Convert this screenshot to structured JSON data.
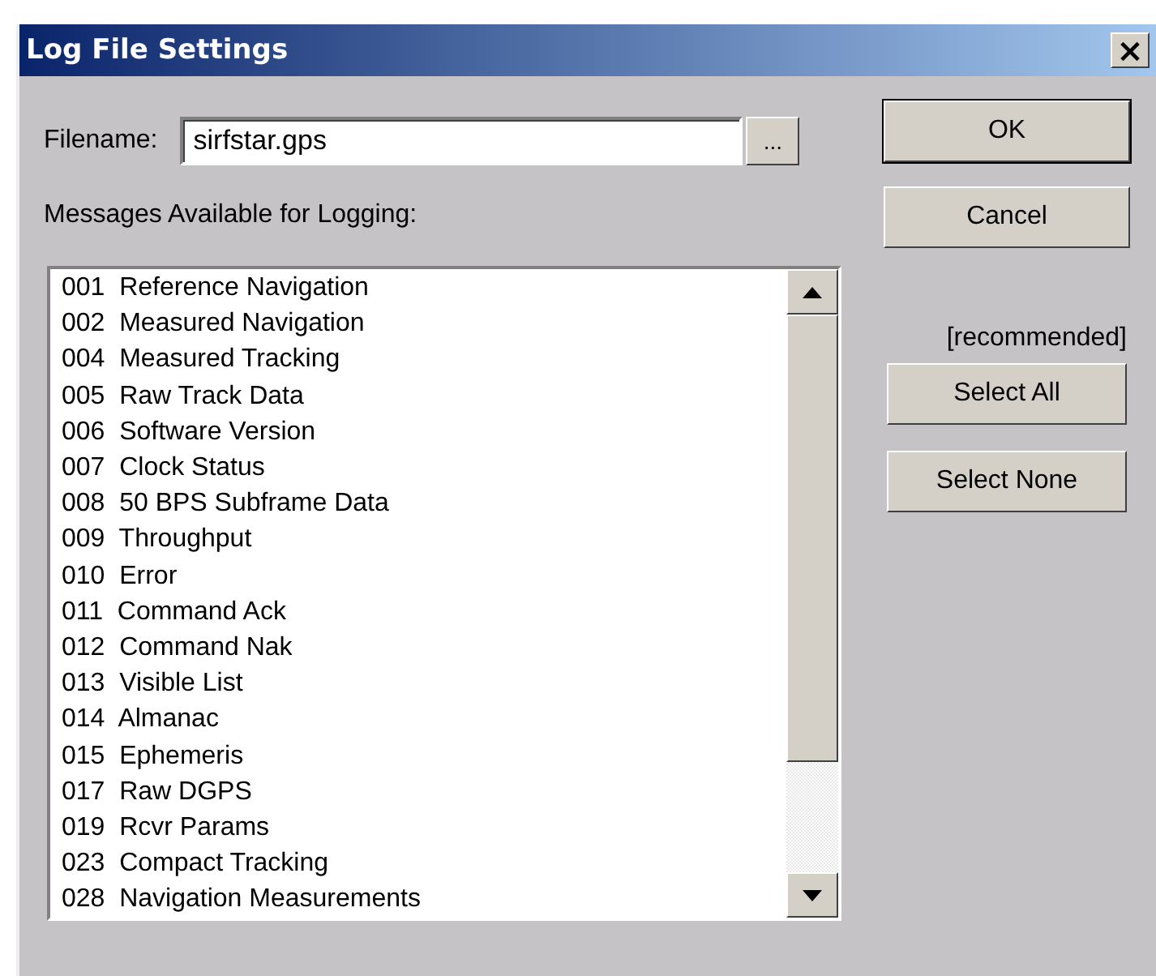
{
  "window": {
    "title": "Log File Settings",
    "close_label": "×"
  },
  "filename": {
    "label": "Filename:",
    "value": "sirfstar.gps",
    "browse_label": "..."
  },
  "messages": {
    "label": "Messages Available for Logging:",
    "items": [
      {
        "text": "001  Reference Navigation"
      },
      {
        "text": "002  Measured Navigation"
      },
      {
        "text": "004  Measured Tracking"
      },
      {
        "text": "005  Raw Track Data"
      },
      {
        "text": "006  Software Version"
      },
      {
        "text": "007  Clock Status"
      },
      {
        "text": "008  50 BPS Subframe Data"
      },
      {
        "text": "009  Throughput"
      },
      {
        "text": "010  Error"
      },
      {
        "text": "011  Command Ack"
      },
      {
        "text": "012  Command Nak"
      },
      {
        "text": "013  Visible List"
      },
      {
        "text": "014  Almanac"
      },
      {
        "text": "015  Ephemeris"
      },
      {
        "text": "017  Raw DGPS"
      },
      {
        "text": "019  Rcvr Params"
      },
      {
        "text": "023  Compact Tracking"
      },
      {
        "text": "028  Navigation Measurements"
      }
    ]
  },
  "buttons": [
    {
      "label": "OK",
      "default": true
    },
    {
      "label": "Cancel",
      "default": false
    }
  ],
  "recommended_note": "[recommended]",
  "select_buttons": [
    {
      "label": "Select All"
    },
    {
      "label": "Select None"
    }
  ]
}
